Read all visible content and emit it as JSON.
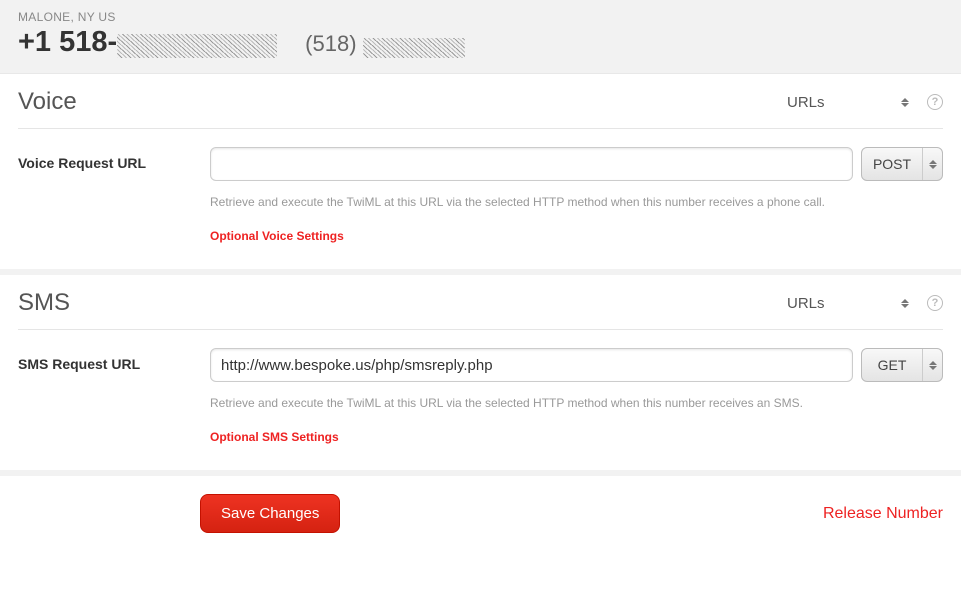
{
  "header": {
    "location": "MALONE, NY US",
    "phone_primary_prefix": "+1 518-",
    "phone_secondary_prefix": "(518)"
  },
  "voice": {
    "title": "Voice",
    "config_mode": "URLs",
    "request_url_label": "Voice Request URL",
    "request_url_value": "",
    "method": "POST",
    "help_text": "Retrieve and execute the TwiML at this URL via the selected HTTP method when this number receives a phone call.",
    "optional_link": "Optional Voice Settings"
  },
  "sms": {
    "title": "SMS",
    "config_mode": "URLs",
    "request_url_label": "SMS Request URL",
    "request_url_value": "http://www.bespoke.us/php/smsreply.php",
    "method": "GET",
    "help_text": "Retrieve and execute the TwiML at this URL via the selected HTTP method when this number receives an SMS.",
    "optional_link": "Optional SMS Settings"
  },
  "footer": {
    "save_label": "Save Changes",
    "release_label": "Release Number"
  }
}
